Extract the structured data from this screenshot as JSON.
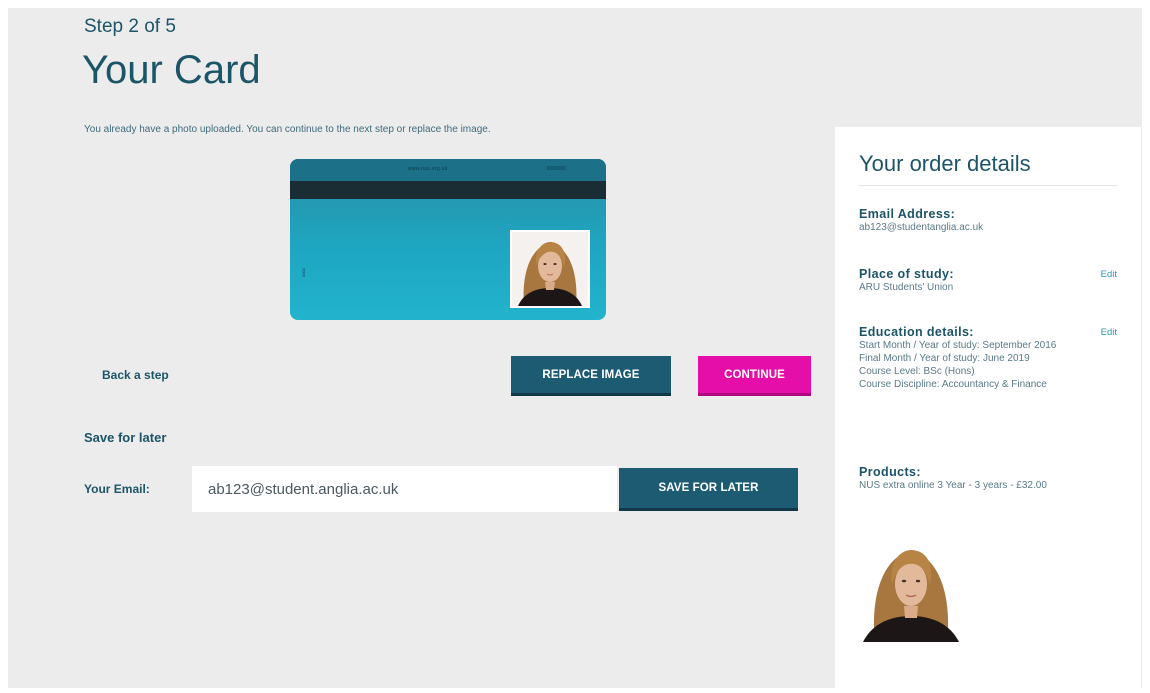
{
  "header": {
    "step": "Step 2 of 5",
    "title": "Your Card",
    "intro": "You already have a photo uploaded. You can continue to the next step or replace the image."
  },
  "card": {
    "url_text": "www.nus.org.uk",
    "id_text": "0000000",
    "side_text": "0000"
  },
  "actions": {
    "back_label": "Back a step",
    "replace_label": "REPLACE IMAGE",
    "continue_label": "CONTINUE"
  },
  "save": {
    "title": "Save for later",
    "email_label": "Your Email:",
    "email_value": "ab123@student.anglia.ac.uk",
    "button_label": "SAVE FOR LATER"
  },
  "sidebar": {
    "title": "Your order details",
    "email": {
      "heading": "Email Address:",
      "value": "ab123@studentanglia.ac.uk"
    },
    "place": {
      "heading": "Place of study:",
      "value": "ARU Students' Union",
      "edit": "Edit"
    },
    "education": {
      "heading": "Education details:",
      "edit": "Edit",
      "lines": [
        "Start Month / Year of study: September 2016",
        "Final Month / Year of study: June 2019",
        "Course Level: BSc (Hons)",
        "Course Discipline: Accountancy & Finance"
      ]
    },
    "products": {
      "heading": "Products:",
      "value": "NUS extra online 3 Year - 3 years - £32.00"
    }
  },
  "colors": {
    "brand": "#1c5468",
    "button_primary": "#1d5b72",
    "button_accent": "#e60ea8",
    "background": "#ececec"
  }
}
